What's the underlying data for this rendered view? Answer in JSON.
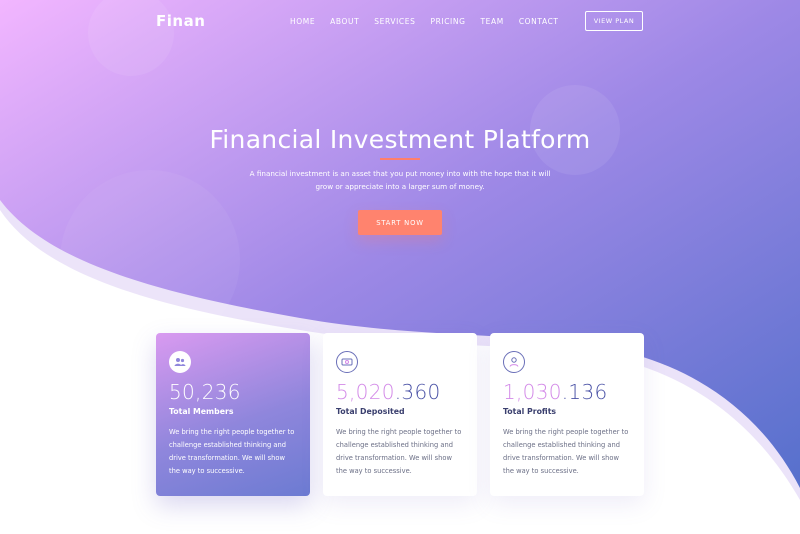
{
  "brand": {
    "logo": "Finan"
  },
  "nav": {
    "items": [
      "HOME",
      "ABOUT",
      "SERVICES",
      "PRICING",
      "TEAM",
      "CONTACT"
    ],
    "cta": "VIEW PLAN"
  },
  "hero": {
    "title": "Financial Investment Platform",
    "description": "A financial investment is an asset that you put money into with the hope that it will grow or appreciate into a larger sum of money.",
    "button": "START NOW"
  },
  "stats": [
    {
      "value": "50,236",
      "label": "Total Members",
      "icon": "users-icon",
      "text": "We bring the right people together to challenge established thinking and drive transformation. We will show the way to successive."
    },
    {
      "value_prefix": "5,020",
      "value_suffix": ".360",
      "label": "Total Deposited",
      "icon": "money-icon",
      "text": "We bring the right people together to challenge established thinking and drive transformation. We will show the way to successive."
    },
    {
      "value_prefix": "1,030",
      "value_suffix": ".136",
      "label": "Total Profits",
      "icon": "profit-icon",
      "text": "We bring the right people together to challenge established thinking and drive transformation. We will show the way to successive."
    }
  ],
  "colors": {
    "gradient_start": "#efb4ff",
    "gradient_end": "#5b72cf",
    "accent": "#ff836e"
  }
}
